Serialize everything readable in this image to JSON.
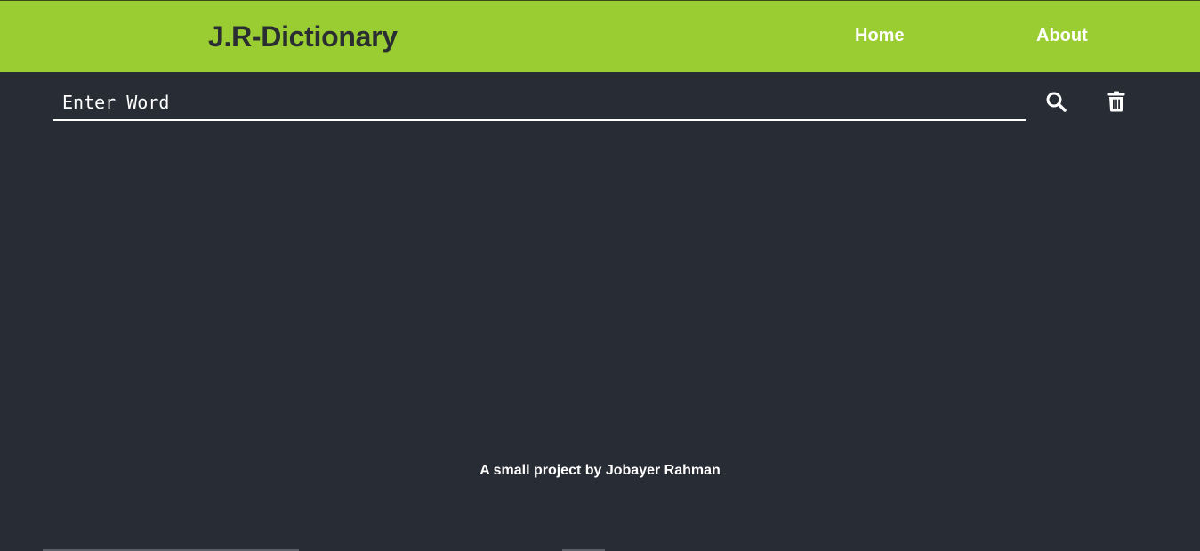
{
  "header": {
    "brand": "J.R-Dictionary",
    "nav": [
      {
        "label": "Home"
      },
      {
        "label": "About"
      }
    ],
    "background_color": "#9acd32"
  },
  "search": {
    "placeholder": "Enter Word",
    "value": "",
    "search_icon": "search-icon",
    "delete_icon": "trash-icon"
  },
  "footer": {
    "credit": "A small project by Jobayer Rahman"
  },
  "colors": {
    "page_background": "#282c35",
    "text": "#ffffff",
    "brand_text": "#2a2e33"
  }
}
